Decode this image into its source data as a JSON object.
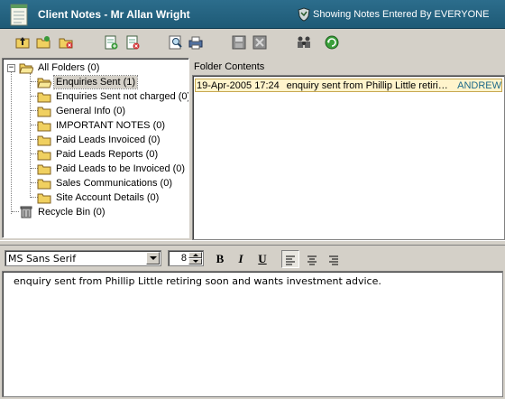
{
  "window": {
    "title": "Client Notes - Mr Allan Wright",
    "filter_status": "Showing Notes Entered By EVERYONE"
  },
  "toolbar": {
    "buttons": [
      "folder-up-icon",
      "new-folder-icon",
      "delete-folder-icon",
      "new-note-icon",
      "delete-note-icon",
      "find-icon",
      "print-icon",
      "save-icon",
      "cancel-icon",
      "users-icon",
      "refresh-icon"
    ]
  },
  "tree": {
    "root": "All Folders (0)",
    "folders": [
      {
        "label": "Enquiries Sent (1)",
        "selected": true
      },
      {
        "label": "Enquiries Sent not charged (0)"
      },
      {
        "label": "General Info (0)"
      },
      {
        "label": "IMPORTANT NOTES (0)"
      },
      {
        "label": "Paid Leads Invoiced (0)"
      },
      {
        "label": "Paid Leads Reports (0)"
      },
      {
        "label": "Paid Leads to be Invoiced (0)"
      },
      {
        "label": "Sales Communications (0)"
      },
      {
        "label": "Site Account Details (0)"
      }
    ],
    "recycle_bin": "Recycle Bin (0)"
  },
  "contents": {
    "header": "Folder Contents",
    "notes": [
      {
        "date": "19-Apr-2005 17:24",
        "subject": "enquiry sent from Phillip Little retiring soon and wants investment advice.",
        "author": "ANDREW"
      }
    ]
  },
  "format": {
    "font": "MS Sans Serif",
    "size": "8",
    "bold_label": "B",
    "italic_label": "I",
    "underline_label": "U"
  },
  "editor": {
    "text": "enquiry sent from Phillip Little retiring soon and wants investment advice."
  }
}
